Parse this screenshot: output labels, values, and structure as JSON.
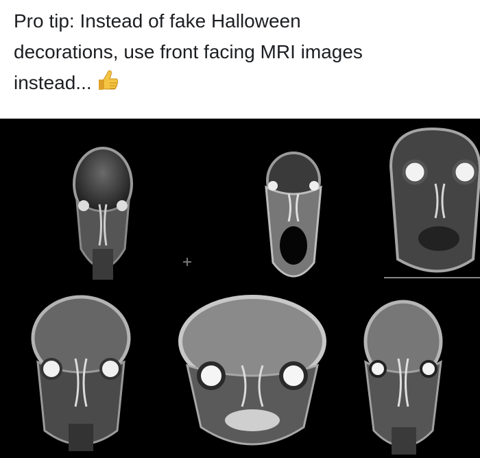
{
  "post": {
    "text_lines": [
      "Pro tip: Instead of fake Halloween",
      "decorations, use front facing MRI images",
      "instead..."
    ],
    "emoji": "thumbs-up-icon"
  },
  "image": {
    "panels": [
      "mri-scan-1",
      "mri-scan-2",
      "mri-scan-3",
      "mri-scan-4",
      "mri-scan-5",
      "mri-scan-6"
    ]
  }
}
